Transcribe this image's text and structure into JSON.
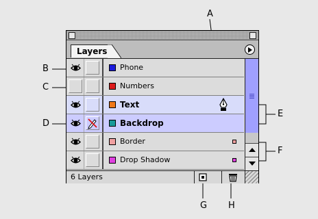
{
  "panel": {
    "tab_label": "Layers",
    "layer_count": "6 Layers"
  },
  "layers": [
    {
      "name": "Phone",
      "color": "#1a1adc",
      "visible": true,
      "locked": false,
      "bold": false
    },
    {
      "name": "Numbers",
      "color": "#dc1a1a",
      "visible": false,
      "locked": false,
      "bold": false
    },
    {
      "name": "Text",
      "color": "#f07818",
      "visible": true,
      "locked": false,
      "bold": true,
      "indicator": "pen-icon"
    },
    {
      "name": "Backdrop",
      "color": "#1a9a9a",
      "visible": true,
      "locked": true,
      "bold": true
    },
    {
      "name": "Border",
      "color": "#f0a0a0",
      "visible": true,
      "locked": false,
      "bold": false,
      "selection_mark": "#f0a0a0"
    },
    {
      "name": "Drop Shadow",
      "color": "#e040e0",
      "visible": true,
      "locked": false,
      "bold": false,
      "selection_mark": "#e040e0"
    }
  ],
  "callouts": {
    "a": "A",
    "b": "B",
    "c": "C",
    "d": "D",
    "e": "E",
    "f": "F",
    "g": "G",
    "h": "H"
  },
  "icons": [
    "eye-icon",
    "lock-crossed-pencil-icon",
    "pen-icon",
    "new-layer-icon",
    "trash-icon",
    "panel-menu-icon",
    "scroll-up-arrow-icon",
    "scroll-down-arrow-icon",
    "resize-grip-icon"
  ]
}
